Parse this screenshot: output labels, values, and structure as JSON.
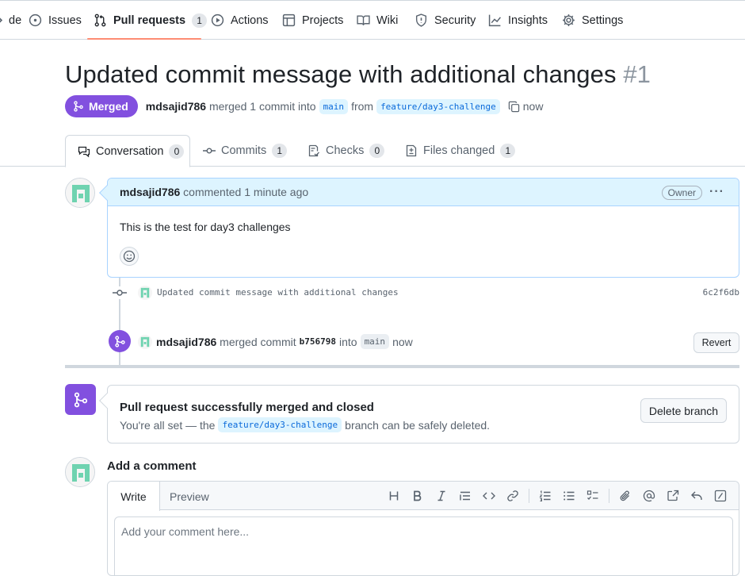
{
  "repo_nav": {
    "items": [
      {
        "label": "de",
        "icon": "code-icon"
      },
      {
        "label": "Issues",
        "icon": "issue-opened-icon"
      },
      {
        "label": "Pull requests",
        "icon": "git-pull-request-icon",
        "count": "1",
        "active": true
      },
      {
        "label": "Actions",
        "icon": "play-icon"
      },
      {
        "label": "Projects",
        "icon": "table-icon"
      },
      {
        "label": "Wiki",
        "icon": "book-icon"
      },
      {
        "label": "Security",
        "icon": "shield-icon"
      },
      {
        "label": "Insights",
        "icon": "graph-icon"
      },
      {
        "label": "Settings",
        "icon": "gear-icon"
      }
    ],
    "active_underline_color": "#fd8c73"
  },
  "pr": {
    "title": "Updated commit message with additional changes",
    "number": "#1",
    "state": "Merged",
    "state_color": "#8250df",
    "author": "mdsajid786",
    "merged_text": "merged 1 commit into",
    "base_branch": "main",
    "from_text": "from",
    "head_branch": "feature/day3-challenge",
    "time": "now"
  },
  "tabs": [
    {
      "label": "Conversation",
      "count": "0",
      "icon": "comment-discussion-icon",
      "active": true
    },
    {
      "label": "Commits",
      "count": "1",
      "icon": "git-commit-icon"
    },
    {
      "label": "Checks",
      "count": "0",
      "icon": "checklist-icon"
    },
    {
      "label": "Files changed",
      "count": "1",
      "icon": "file-diff-icon"
    }
  ],
  "comment": {
    "author": "mdsajid786",
    "action": "commented 1 minute ago",
    "role": "Owner",
    "body": "This is the test for day3 challenges"
  },
  "timeline": {
    "commit_message": "Updated commit message with additional changes",
    "commit_sha": "6c2f6db",
    "merge_event": {
      "author": "mdsajid786",
      "text": "merged commit",
      "sha": "b756798",
      "into_text": "into",
      "branch": "main",
      "time": "now",
      "revert_label": "Revert"
    }
  },
  "merge_status": {
    "title": "Pull request successfully merged and closed",
    "subtitle_before": "You're all set — the",
    "branch": "feature/day3-challenge",
    "subtitle_after": "branch can be safely deleted.",
    "delete_button": "Delete branch"
  },
  "add_comment": {
    "title": "Add a comment",
    "tabs": [
      "Write",
      "Preview"
    ],
    "placeholder": "Add your comment here..."
  },
  "avatar_color": "#6fd3b0"
}
